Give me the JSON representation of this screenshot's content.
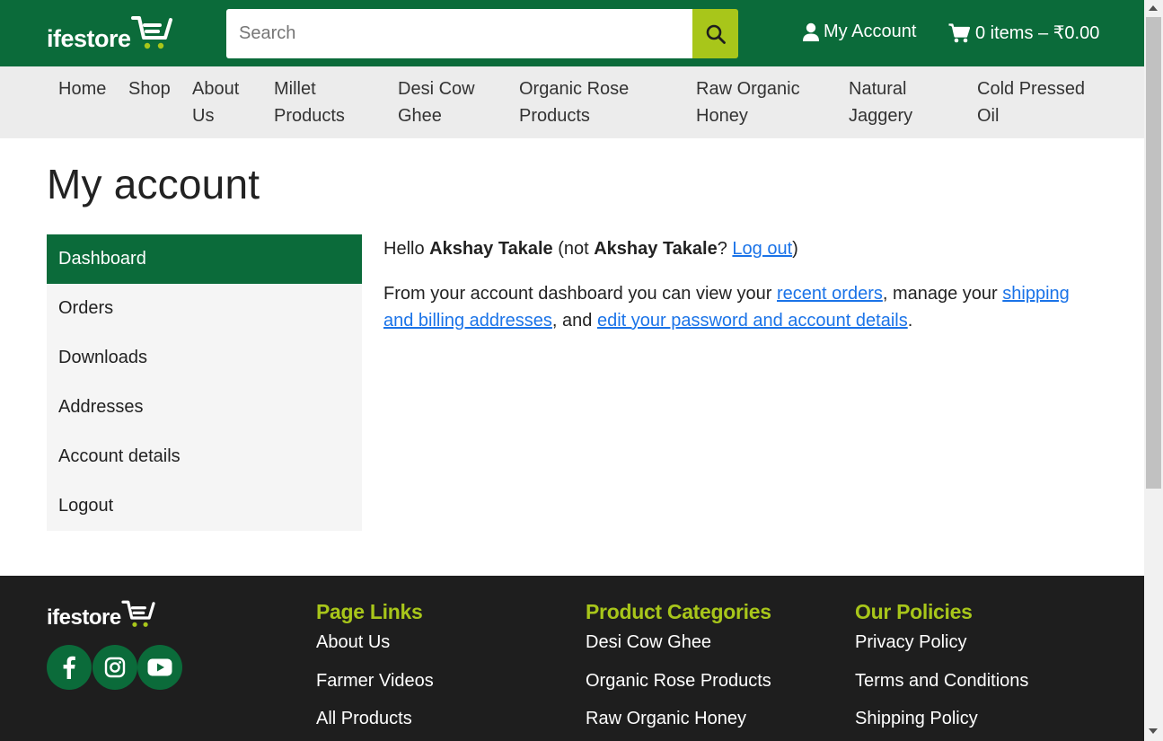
{
  "header": {
    "logo_text": "ifestore",
    "search_placeholder": "Search",
    "account_label": "My Account",
    "cart_label": "0 items – ₹0.00"
  },
  "nav": {
    "items": [
      {
        "label": "Home"
      },
      {
        "label": "Shop"
      },
      {
        "label": "About\nUs"
      },
      {
        "label": "Millet\nProducts"
      },
      {
        "label": "Desi Cow\nGhee"
      },
      {
        "label": "Organic Rose\nProducts"
      },
      {
        "label": "Raw Organic\nHoney"
      },
      {
        "label": "Natural\nJaggery"
      },
      {
        "label": "Cold Pressed\nOil"
      }
    ]
  },
  "page": {
    "title": "My account"
  },
  "account_nav": {
    "items": [
      {
        "label": "Dashboard",
        "active": true
      },
      {
        "label": "Orders"
      },
      {
        "label": "Downloads"
      },
      {
        "label": "Addresses"
      },
      {
        "label": "Account details"
      },
      {
        "label": "Logout"
      }
    ]
  },
  "dashboard": {
    "hello": "Hello",
    "user_name": "Akshay Takale",
    "not_prefix": "(not",
    "not_name": "Akshay Takale",
    "question": "?",
    "logout_link": "Log out",
    "close_paren": ")",
    "intro_text": "From your account dashboard you can view your",
    "recent_orders_link": "recent orders",
    "manage_text": ", manage your",
    "addresses_link": "shipping and billing addresses",
    "and_text": ", and",
    "account_link": "edit your password and account details",
    "period": "."
  },
  "footer": {
    "logo_text": "ifestore",
    "socials": [
      "facebook-icon",
      "instagram-icon",
      "youtube-icon"
    ],
    "columns": [
      {
        "title": "Page Links",
        "links": [
          "About Us",
          "Farmer Videos",
          "All Products"
        ]
      },
      {
        "title": "Product Categories",
        "links": [
          "Desi Cow Ghee",
          "Organic Rose Products",
          "Raw Organic Honey"
        ]
      },
      {
        "title": "Our Policies",
        "links": [
          "Privacy Policy",
          "Terms and Conditions",
          "Shipping Policy"
        ]
      }
    ]
  },
  "colors": {
    "brand_green": "#0b6b3a",
    "accent_lime": "#a8c61a",
    "link_blue": "#1a73e8",
    "footer_bg": "#1e1e1e"
  }
}
